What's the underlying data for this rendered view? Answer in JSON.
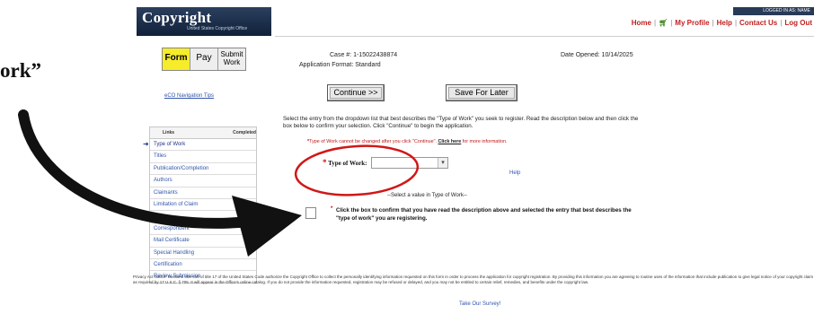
{
  "overlay_text": "ork”",
  "header": {
    "brand_title": "Copyright",
    "brand_sub": "United States Copyright Office",
    "user_label": "LOGGED IN AS: NAME",
    "nav": [
      "Home",
      "My Profile",
      "Help",
      "Contact Us",
      "Log Out"
    ]
  },
  "tabs": [
    {
      "label": "Form",
      "active": true
    },
    {
      "label": "Pay",
      "active": false
    },
    {
      "label": "Submit Work",
      "active": false
    }
  ],
  "case": {
    "case_label": "Case #:",
    "case_value": "1-15022438874",
    "format_label": "Application Format:",
    "format_value": "Standard",
    "date_label": "Date Opened:",
    "date_value": "10/14/2025"
  },
  "nav_tips": "eCO Navigation Tips",
  "buttons": {
    "continue": "Continue >>",
    "save_later": "Save For Later"
  },
  "left_table": {
    "col_links": "Links",
    "col_completed": "Completed",
    "items": [
      "Type of Work",
      "Titles",
      "Publication/Completion",
      "Authors",
      "Claimants",
      "Limitation of Claim",
      "",
      "Correspondent",
      "Mail Certificate",
      "Special Handling",
      "Certification",
      "Review Submission"
    ]
  },
  "description": "Select the entry from the dropdown list that best describes the \"Type of Work\" you seek to register. Read the description below and then click the box below to confirm your selection. Click \"Continue\" to begin the application.",
  "warning": {
    "text1": "Type of Work cannot be changed after you click \"Continue\". ",
    "link": "Click here",
    "text2": " for more information."
  },
  "type_of_work_label": "Type of Work:",
  "type_of_work_value": "",
  "help": "Help",
  "select_message": "--Select a value in Type of Work--",
  "confirm_text": "Click the box to confirm that you have read the description above and selected the entry that best describes the \"type of work\" you are registering.",
  "privacy": "Privacy Act Notice: Sections 408-410 of title 17 of the United States Code authorize the Copyright Office to collect the personally identifying information requested on this form in order to process the application for copyright registration. By providing this information you are agreeing to routine uses of the information that include publication to give legal notice of your copyright claim as required by 17 U.S.C. § 705. It will appear in the Office's online catalog. If you do not provide the information requested, registration may be refused or delayed, and you may not be entitled to certain relief, remedies, and benefits under the copyright law.",
  "survey": "Take Our Survey!",
  "colors": {
    "active_tab": "#f6ec2a",
    "annotation": "#d01818",
    "nav_red": "#c02020",
    "brand_navy": "#1a2b47"
  }
}
